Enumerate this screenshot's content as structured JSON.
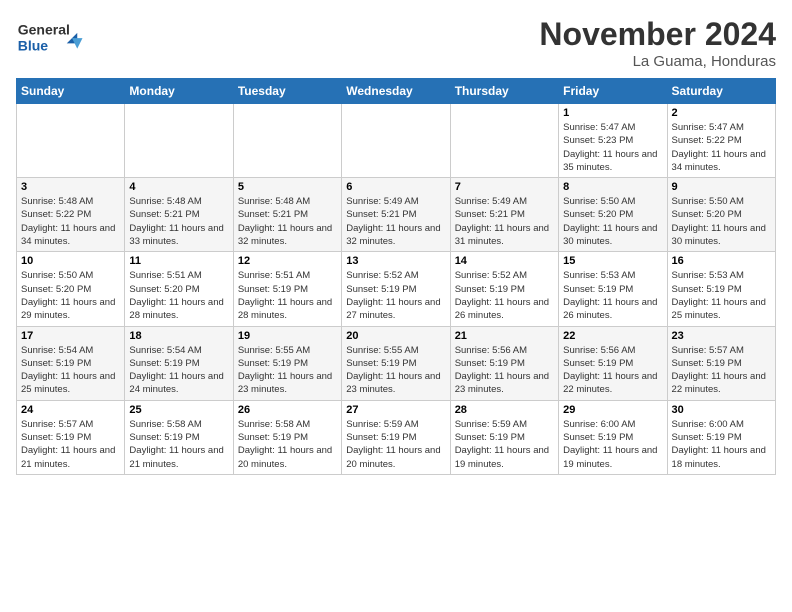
{
  "header": {
    "logo_line1": "General",
    "logo_line2": "Blue",
    "month_title": "November 2024",
    "location": "La Guama, Honduras"
  },
  "days_of_week": [
    "Sunday",
    "Monday",
    "Tuesday",
    "Wednesday",
    "Thursday",
    "Friday",
    "Saturday"
  ],
  "weeks": [
    [
      {
        "day": "",
        "info": ""
      },
      {
        "day": "",
        "info": ""
      },
      {
        "day": "",
        "info": ""
      },
      {
        "day": "",
        "info": ""
      },
      {
        "day": "",
        "info": ""
      },
      {
        "day": "1",
        "info": "Sunrise: 5:47 AM\nSunset: 5:23 PM\nDaylight: 11 hours\nand 35 minutes."
      },
      {
        "day": "2",
        "info": "Sunrise: 5:47 AM\nSunset: 5:22 PM\nDaylight: 11 hours\nand 34 minutes."
      }
    ],
    [
      {
        "day": "3",
        "info": "Sunrise: 5:48 AM\nSunset: 5:22 PM\nDaylight: 11 hours\nand 34 minutes."
      },
      {
        "day": "4",
        "info": "Sunrise: 5:48 AM\nSunset: 5:21 PM\nDaylight: 11 hours\nand 33 minutes."
      },
      {
        "day": "5",
        "info": "Sunrise: 5:48 AM\nSunset: 5:21 PM\nDaylight: 11 hours\nand 32 minutes."
      },
      {
        "day": "6",
        "info": "Sunrise: 5:49 AM\nSunset: 5:21 PM\nDaylight: 11 hours\nand 32 minutes."
      },
      {
        "day": "7",
        "info": "Sunrise: 5:49 AM\nSunset: 5:21 PM\nDaylight: 11 hours\nand 31 minutes."
      },
      {
        "day": "8",
        "info": "Sunrise: 5:50 AM\nSunset: 5:20 PM\nDaylight: 11 hours\nand 30 minutes."
      },
      {
        "day": "9",
        "info": "Sunrise: 5:50 AM\nSunset: 5:20 PM\nDaylight: 11 hours\nand 30 minutes."
      }
    ],
    [
      {
        "day": "10",
        "info": "Sunrise: 5:50 AM\nSunset: 5:20 PM\nDaylight: 11 hours\nand 29 minutes."
      },
      {
        "day": "11",
        "info": "Sunrise: 5:51 AM\nSunset: 5:20 PM\nDaylight: 11 hours\nand 28 minutes."
      },
      {
        "day": "12",
        "info": "Sunrise: 5:51 AM\nSunset: 5:19 PM\nDaylight: 11 hours\nand 28 minutes."
      },
      {
        "day": "13",
        "info": "Sunrise: 5:52 AM\nSunset: 5:19 PM\nDaylight: 11 hours\nand 27 minutes."
      },
      {
        "day": "14",
        "info": "Sunrise: 5:52 AM\nSunset: 5:19 PM\nDaylight: 11 hours\nand 26 minutes."
      },
      {
        "day": "15",
        "info": "Sunrise: 5:53 AM\nSunset: 5:19 PM\nDaylight: 11 hours\nand 26 minutes."
      },
      {
        "day": "16",
        "info": "Sunrise: 5:53 AM\nSunset: 5:19 PM\nDaylight: 11 hours\nand 25 minutes."
      }
    ],
    [
      {
        "day": "17",
        "info": "Sunrise: 5:54 AM\nSunset: 5:19 PM\nDaylight: 11 hours\nand 25 minutes."
      },
      {
        "day": "18",
        "info": "Sunrise: 5:54 AM\nSunset: 5:19 PM\nDaylight: 11 hours\nand 24 minutes."
      },
      {
        "day": "19",
        "info": "Sunrise: 5:55 AM\nSunset: 5:19 PM\nDaylight: 11 hours\nand 23 minutes."
      },
      {
        "day": "20",
        "info": "Sunrise: 5:55 AM\nSunset: 5:19 PM\nDaylight: 11 hours\nand 23 minutes."
      },
      {
        "day": "21",
        "info": "Sunrise: 5:56 AM\nSunset: 5:19 PM\nDaylight: 11 hours\nand 23 minutes."
      },
      {
        "day": "22",
        "info": "Sunrise: 5:56 AM\nSunset: 5:19 PM\nDaylight: 11 hours\nand 22 minutes."
      },
      {
        "day": "23",
        "info": "Sunrise: 5:57 AM\nSunset: 5:19 PM\nDaylight: 11 hours\nand 22 minutes."
      }
    ],
    [
      {
        "day": "24",
        "info": "Sunrise: 5:57 AM\nSunset: 5:19 PM\nDaylight: 11 hours\nand 21 minutes."
      },
      {
        "day": "25",
        "info": "Sunrise: 5:58 AM\nSunset: 5:19 PM\nDaylight: 11 hours\nand 21 minutes."
      },
      {
        "day": "26",
        "info": "Sunrise: 5:58 AM\nSunset: 5:19 PM\nDaylight: 11 hours\nand 20 minutes."
      },
      {
        "day": "27",
        "info": "Sunrise: 5:59 AM\nSunset: 5:19 PM\nDaylight: 11 hours\nand 20 minutes."
      },
      {
        "day": "28",
        "info": "Sunrise: 5:59 AM\nSunset: 5:19 PM\nDaylight: 11 hours\nand 19 minutes."
      },
      {
        "day": "29",
        "info": "Sunrise: 6:00 AM\nSunset: 5:19 PM\nDaylight: 11 hours\nand 19 minutes."
      },
      {
        "day": "30",
        "info": "Sunrise: 6:00 AM\nSunset: 5:19 PM\nDaylight: 11 hours\nand 18 minutes."
      }
    ]
  ]
}
